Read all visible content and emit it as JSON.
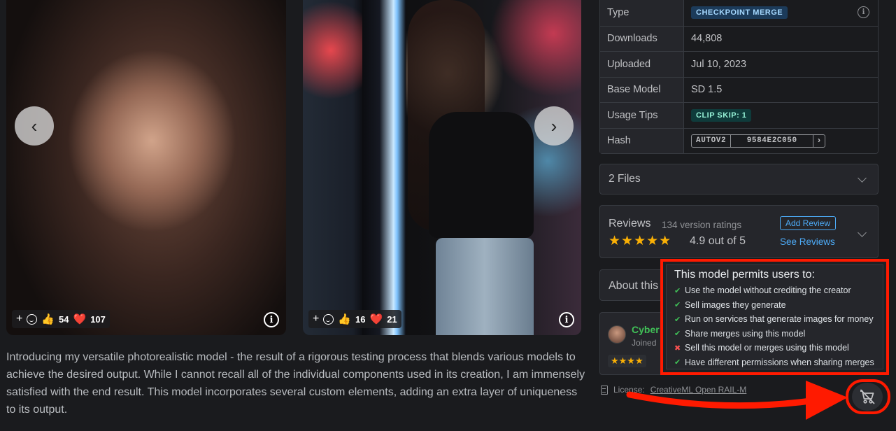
{
  "gallery": {
    "prev_glyph": "‹",
    "next_glyph": "›",
    "cards": [
      {
        "add_glyph": "+",
        "likes": "54",
        "hearts": "107"
      },
      {
        "add_glyph": "+",
        "likes": "16",
        "hearts": "21"
      }
    ],
    "info_glyph": "i"
  },
  "description": "Introducing my versatile photorealistic model - the result of a rigorous testing process that blends various models to achieve the desired output. While I cannot recall all of the individual components used in its creation, I am immensely satisfied with the end result. This model incorporates several custom elements, adding an extra layer of uniqueness to its output.",
  "details": {
    "rows": [
      {
        "key": "Type",
        "value": "CHECKPOINT MERGE"
      },
      {
        "key": "Downloads",
        "value": "44,808"
      },
      {
        "key": "Uploaded",
        "value": "Jul 10, 2023"
      },
      {
        "key": "Base Model",
        "value": "SD 1.5"
      },
      {
        "key": "Usage Tips",
        "value": "CLIP SKIP: 1"
      },
      {
        "key": "Hash",
        "value": ""
      }
    ],
    "hash_algo": "AUTOV2",
    "hash_value": "9584E2C050",
    "hash_copy_glyph": "›"
  },
  "files": {
    "title": "2 Files"
  },
  "reviews": {
    "title": "Reviews",
    "count": "134 version ratings",
    "stars": "★★★★★",
    "score": "4.9 out of 5",
    "add_label": "Add Review",
    "see_label": "See Reviews"
  },
  "about": {
    "title": "About this"
  },
  "creator": {
    "name": "Cyber",
    "joined": "Joined",
    "stars": "★★★★"
  },
  "license": {
    "prefix": "License:",
    "name": "CreativeML Open RAIL-M"
  },
  "permissions": {
    "heading": "This model permits users to:",
    "items": [
      {
        "label": "Use the model without crediting the creator",
        "allowed": true
      },
      {
        "label": "Sell images they generate",
        "allowed": true
      },
      {
        "label": "Run on services that generate images for money",
        "allowed": true
      },
      {
        "label": "Share merges using this model",
        "allowed": true
      },
      {
        "label": "Sell this model or merges using this model",
        "allowed": false
      },
      {
        "label": "Have different permissions when sharing merges",
        "allowed": true
      }
    ],
    "yes_glyph": "✔",
    "no_glyph": "✖"
  },
  "colors": {
    "accent": "#4dabf7",
    "annotation": "#ff1a00",
    "allowed": "#40c057",
    "denied": "#fa5252",
    "star": "#fab005"
  },
  "icons": {
    "cart": "cart-off-icon",
    "info": "info-circle-icon",
    "chevron": "chevron-down-icon"
  }
}
